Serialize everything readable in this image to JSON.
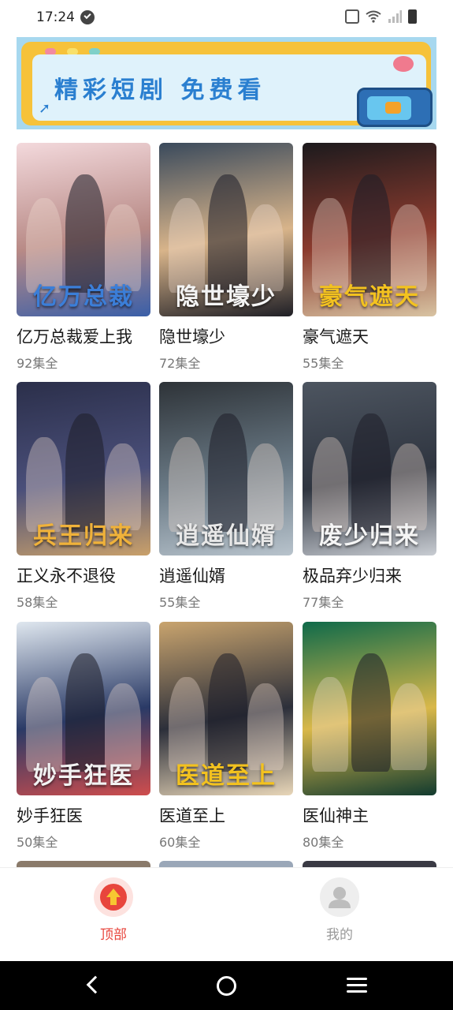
{
  "status_bar": {
    "time": "17:24"
  },
  "banner": {
    "text": "精彩短剧 免费看",
    "colors": {
      "frame": "#f6c23a",
      "text": "#2a7fd0",
      "sky": "#a7d8ef"
    }
  },
  "dramas": [
    {
      "title": "亿万总裁爱上我",
      "episodes": "92集全",
      "poster_art": "亿万总裁",
      "palette": [
        "#f3d9dc",
        "#b88a86",
        "#3a5fa8"
      ],
      "art_color": "#3b7ed8"
    },
    {
      "title": "隐世壕少",
      "episodes": "72集全",
      "poster_art": "隐世壕少",
      "palette": [
        "#3a4a5c",
        "#d8b48a",
        "#1f1f26"
      ],
      "art_color": "#f4f4f4"
    },
    {
      "title": "豪气遮天",
      "episodes": "55集全",
      "poster_art": "豪气遮天",
      "palette": [
        "#1c1a1d",
        "#8b3b2e",
        "#d8c3a2"
      ],
      "art_color": "#f3c21f"
    },
    {
      "title": "正义永不退役",
      "episodes": "58集全",
      "poster_art": "兵王归来",
      "palette": [
        "#2b2f4a",
        "#4a4f7a",
        "#c9a06a"
      ],
      "art_color": "#f0b23a"
    },
    {
      "title": "逍遥仙婿",
      "episodes": "55集全",
      "poster_art": "逍遥仙婿",
      "palette": [
        "#2e3338",
        "#6a7a86",
        "#b8c3cc"
      ],
      "art_color": "#e8e8e8"
    },
    {
      "title": "极品弃少归来",
      "episodes": "77集全",
      "poster_art": "废少归来",
      "palette": [
        "#4d5560",
        "#2f3540",
        "#c8ccd2"
      ],
      "art_color": "#f5f5f5"
    },
    {
      "title": "妙手狂医",
      "episodes": "50集全",
      "poster_art": "妙手狂医",
      "palette": [
        "#dfe7ef",
        "#2a3a66",
        "#cf4d4d"
      ],
      "art_color": "#f2f2f2"
    },
    {
      "title": "医道至上",
      "episodes": "60集全",
      "poster_art": "医道至上",
      "palette": [
        "#c9a46e",
        "#2c2f3a",
        "#e8d6b8"
      ],
      "art_color": "#f3c21f"
    },
    {
      "title": "医仙神主",
      "episodes": "80集全",
      "poster_art": "",
      "palette": [
        "#0f6a4a",
        "#d9b84a",
        "#123b2f"
      ],
      "art_color": "#f3c21f"
    }
  ],
  "tabs": [
    {
      "label": "顶部",
      "icon": "arrow-up-icon",
      "active": true,
      "color": "#e8453c"
    },
    {
      "label": "我的",
      "icon": "user-icon",
      "active": false,
      "color": "#999999"
    }
  ],
  "nav": {
    "back": "back-icon",
    "home": "home-icon",
    "recents": "recents-icon"
  }
}
